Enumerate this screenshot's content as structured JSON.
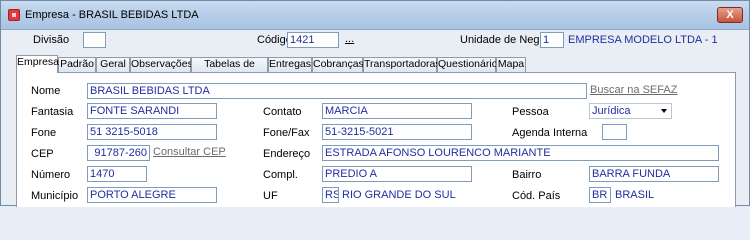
{
  "window": {
    "title": "Empresa - BRASIL BEBIDAS LTDA",
    "close_glyph": "X"
  },
  "header": {
    "divisao_label": "Divisão",
    "divisao_value": "",
    "codigo_label": "Código",
    "codigo_value": "1421",
    "codigo_lookup": "...",
    "unidade_label": "Unidade de Negócio",
    "unidade_value": "1",
    "unidade_name": "EMPRESA MODELO LTDA - 1"
  },
  "tabs": [
    {
      "label": "Empresa",
      "active": true
    },
    {
      "label": "Padrão"
    },
    {
      "label": "Geral"
    },
    {
      "label": "Observações"
    },
    {
      "label": "Tabelas de Preço"
    },
    {
      "label": "Entregas"
    },
    {
      "label": "Cobranças"
    },
    {
      "label": "Transportadoras"
    },
    {
      "label": "Questionário"
    },
    {
      "label": "Mapa"
    }
  ],
  "form": {
    "nome_label": "Nome",
    "nome_value": "BRASIL BEBIDAS LTDA",
    "buscar_sefaz": "Buscar na SEFAZ",
    "fantasia_label": "Fantasia",
    "fantasia_value": "FONTE SARANDI",
    "contato_label": "Contato",
    "contato_value": "MARCIA",
    "pessoa_label": "Pessoa",
    "pessoa_value": "Jurídica",
    "fone_label": "Fone",
    "fone_value": "51 3215-5018",
    "fonefax_label": "Fone/Fax",
    "fonefax_value": "51-3215-5021",
    "agenda_label": "Agenda Interna",
    "agenda_value": "",
    "cep_label": "CEP",
    "cep_value": "91787-260",
    "consultar_cep": "Consultar CEP",
    "endereco_label": "Endereço",
    "endereco_value": "ESTRADA AFONSO LOURENCO MARIANTE",
    "numero_label": "Número",
    "numero_value": "1470",
    "compl_label": "Compl.",
    "compl_value": "PREDIO A",
    "bairro_label": "Bairro",
    "bairro_value": "BARRA FUNDA",
    "municipio_label": "Município",
    "municipio_value": "PORTO ALEGRE",
    "uf_label": "UF",
    "uf_value": "RS",
    "uf_name": "RIO GRANDE DO SUL",
    "codpais_label": "Cód. País",
    "codpais_value": "BR",
    "pais_name": "BRASIL"
  }
}
